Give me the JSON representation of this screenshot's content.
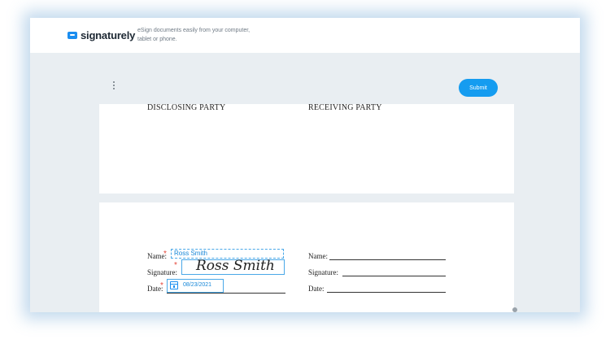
{
  "brand": {
    "name": "signaturely",
    "tagline": "eSign documents easily from your computer, tablet or phone."
  },
  "toolbar": {
    "menu_icon": "kebab-menu-icon",
    "submit_label": "Submit"
  },
  "document": {
    "page1": {
      "disclosing_party": "DISCLOSING PARTY",
      "receiving_party": "RECEIVING PARTY"
    },
    "page2": {
      "left": {
        "name_label": "Name:",
        "signature_label": "Signature:",
        "date_label": "Date:",
        "name_value": "Ross Smith",
        "signature_value": "Ross Smith",
        "date_value": "08/23/2021",
        "required_marker": "*"
      },
      "right": {
        "name_label": "Name:",
        "signature_label": "Signature:",
        "date_label": "Date:"
      }
    }
  },
  "colors": {
    "accent": "#159cf0",
    "field_border": "#4aa8e8",
    "required": "#e5473b",
    "frame_bg": "#e9eef2"
  }
}
